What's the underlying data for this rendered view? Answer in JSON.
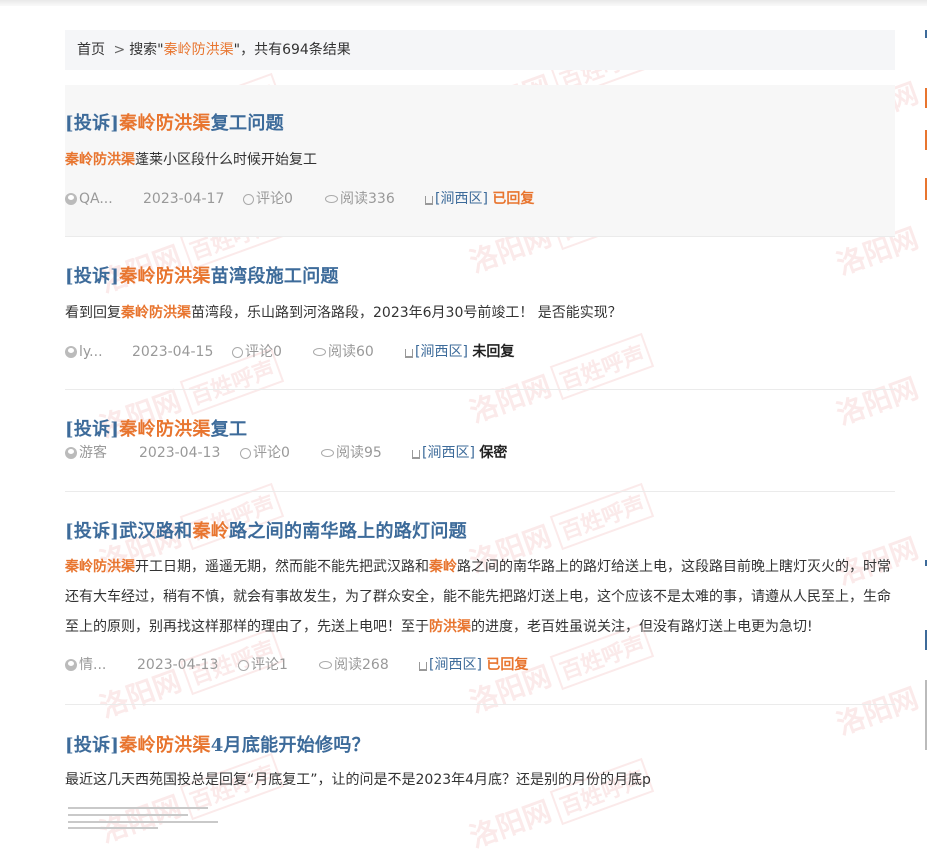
{
  "breadcrumb": {
    "home": "首页",
    "separator": ">",
    "search_prefix": "搜索\"",
    "keyword": "秦岭防洪渠",
    "search_suffix": "\"，共有694条结果"
  },
  "watermark": {
    "text": "洛阳网",
    "badge": "百姓呼声"
  },
  "items": [
    {
      "title_prefix": "[投诉]",
      "title_keyword": "秦岭防洪渠",
      "title_suffix": "复工问题",
      "desc_before": "",
      "desc_keyword": "秦岭防洪渠",
      "desc_after": "蓬莱小区段什么时候开始复工",
      "author": "QA...",
      "date": "2023-04-17",
      "comments": "评论0",
      "reads": "阅读336",
      "region": "[涧西区]",
      "status": "已回复"
    },
    {
      "title_prefix": "[投诉]",
      "title_keyword": "秦岭防洪渠",
      "title_suffix": "苗湾段施工问题",
      "desc_before": "看到回复",
      "desc_keyword": "秦岭防洪渠",
      "desc_after": "苗湾段，乐山路到河洛路段，2023年6月30号前竣工！ 是否能实现？",
      "author": "ly...",
      "date": "2023-04-15",
      "comments": "评论0",
      "reads": "阅读60",
      "region": "[涧西区]",
      "status": "未回复"
    },
    {
      "title_prefix": "[投诉]",
      "title_keyword": "秦岭防洪渠",
      "title_suffix": "复工",
      "author": "游客",
      "date": "2023-04-13",
      "comments": "评论0",
      "reads": "阅读95",
      "region": "[涧西区]",
      "status": "保密"
    },
    {
      "title_prefix": "[投诉]武汉路和",
      "title_keyword": "秦岭",
      "title_suffix": "路之间的南华路上的路灯问题",
      "desc_kw1": "秦岭防洪渠",
      "desc_part1": "开工日期，遥遥无期，然而能不能先把武汉路和",
      "desc_kw2": "秦岭",
      "desc_part2": "路之间的南华路上的路灯给送上电，这段路目前晚上瞎灯灭火的，时常还有大车经过，稍有不慎，就会有事故发生，为了群众安全，能不能先把路灯送上电，这个应该不是太难的事，请遵从人民至上，生命至上的原则，别再找这样那样的理由了，先送上电吧！至于",
      "desc_kw3": "防洪渠",
      "desc_part3": "的进度，老百姓虽说关注，但没有路灯送上电更为急切!",
      "author": "情...",
      "date": "2023-04-13",
      "comments": "评论1",
      "reads": "阅读268",
      "region": "[涧西区]",
      "status": "已回复"
    },
    {
      "title_prefix": "[投诉]",
      "title_keyword": "秦岭防洪渠",
      "title_suffix": "4月底能开始修吗？",
      "desc_before": "最近这几天西苑国投总是回复“月底复工”，让的问是不是2023年4月底？还是别的月份的月底p",
      "desc_keyword": "",
      "desc_after": ""
    }
  ],
  "colors": {
    "keyword": "#e8752f",
    "title": "#3d6b9a",
    "meta": "#999999",
    "watermark": "#e25a5a"
  }
}
